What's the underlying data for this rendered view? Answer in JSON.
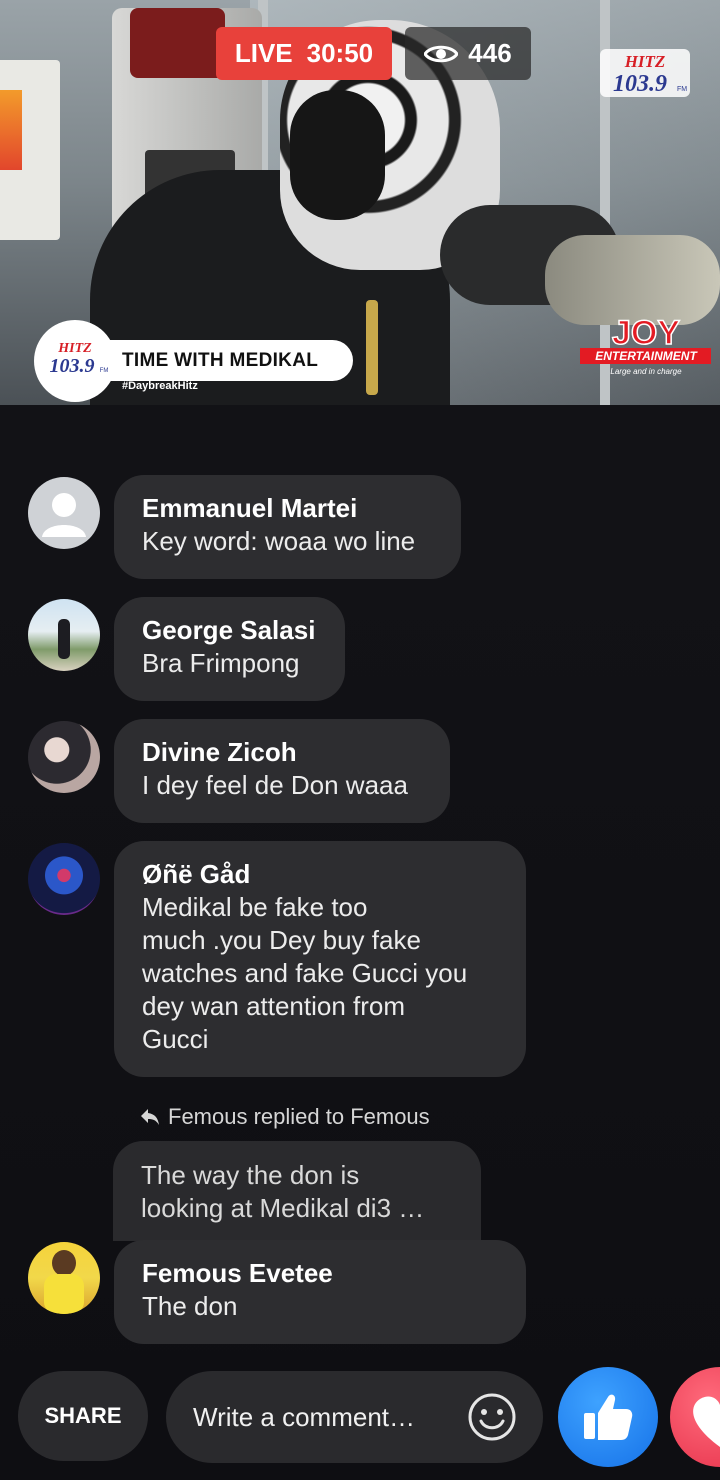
{
  "video": {
    "live_label": "LIVE",
    "elapsed": "30:50",
    "viewer_count": "446",
    "show_title": "TIME WITH MEDIKAL",
    "hashtag": "#DaybreakHitz",
    "station_logo": {
      "line1": "HITZ",
      "line2": "103.9",
      "suffix": "FM"
    },
    "partner_logo": {
      "name": "JOY",
      "sub": "ENTERTAINMENT",
      "tagline": "Large and in charge"
    },
    "colors": {
      "live": "#e8413b",
      "hitz_blue": "#2b3990",
      "hitz_red": "#d71f26"
    }
  },
  "comments": [
    {
      "name": "Emmanuel Martei",
      "text": "Key word: woaa wo line",
      "avatar": "default-avatar"
    },
    {
      "name": "George Salasi",
      "text": "Bra Frimpong",
      "avatar": "photo-avatar"
    },
    {
      "name": "Divine Zicoh",
      "text": "I dey feel de Don waaa",
      "avatar": "photo-avatar"
    },
    {
      "name": "Øñë Gåd",
      "text_lines": [
        "Medikal be fake too",
        "much .you Dey buy fake",
        "watches and fake Gucci you",
        "dey wan attention from",
        "Gucci"
      ],
      "avatar": "photo-avatar"
    },
    {
      "name": "Femous Evetee",
      "text": "The don",
      "avatar": "photo-avatar"
    }
  ],
  "reply": {
    "label": "Femous replied to Femous",
    "text_lines": [
      "The way the don is",
      "looking at Medikal  di3 …"
    ]
  },
  "bottom_bar": {
    "share_label": "SHARE",
    "comment_placeholder": "Write a comment…",
    "emoji_icon": "smiley-icon",
    "like_icon": "thumbs-up-icon",
    "love_icon": "heart-icon",
    "colors": {
      "like": "#1877f2",
      "love": "#f33e58"
    }
  }
}
